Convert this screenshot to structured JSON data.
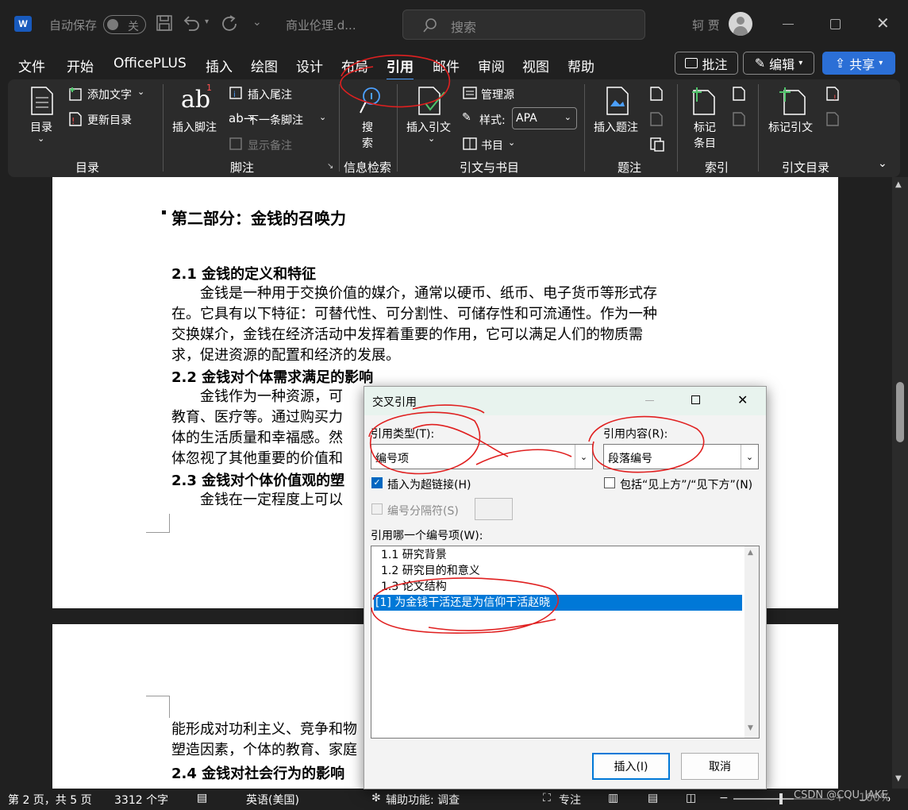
{
  "titlebar": {
    "autosave_label": "自动保存",
    "autosave_state": "关",
    "doc_name": "商业伦理.d...",
    "search_placeholder": "搜索",
    "user_name": "轲 贾"
  },
  "menu": {
    "items": [
      "文件",
      "开始",
      "OfficePLUS",
      "插入",
      "绘图",
      "设计",
      "布局",
      "引用",
      "邮件",
      "审阅",
      "视图",
      "帮助"
    ],
    "active": "引用",
    "comment_btn": "批注",
    "edit_btn": "编辑",
    "share_btn": "共享"
  },
  "ribbon": {
    "toc_btn": "目录",
    "add_text": "添加文字",
    "update_toc": "更新目录",
    "insert_footnote": "插入脚注",
    "insert_endnote": "插入尾注",
    "next_footnote": "下一条脚注",
    "show_notes": "显示备注",
    "search_1": "搜",
    "search_2": "索",
    "insert_citation": "插入引文",
    "manage_sources": "管理源",
    "style_label": "样式:",
    "style_value": "APA",
    "bibliography": "书目",
    "insert_caption": "插入题注",
    "mark_entry_1": "标记",
    "mark_entry_2": "条目",
    "mark_citation": "标记引文",
    "groups": [
      "目录",
      "脚注",
      "信息检索",
      "引文与书目",
      "题注",
      "索引",
      "引文目录"
    ]
  },
  "document": {
    "page1_heading": "第二部分：金钱的召唤力",
    "s21_title": "2.1  金钱的定义和特征",
    "s21_lines": [
      "　　金钱是一种用于交换价值的媒介，通常以硬币、纸币、电子货币等形式存",
      "在。它具有以下特征：可替代性、可分割性、可储存性和可流通性。作为一种",
      "交换媒介，金钱在经济活动中发挥着重要的作用，它可以满足人们的物质需",
      "求，促进资源的配置和经济的发展。"
    ],
    "s22_title": "2.2  金钱对个体需求满足的影响",
    "s22_lines": [
      "　　金钱作为一种资源，可",
      "教育、医疗等。通过购买力",
      "体的生活质量和幸福感。然",
      "体忽视了其他重要的价值和"
    ],
    "s23_title": "2.3  金钱对个体价值观的塑",
    "s23_line": "　　金钱在一定程度上可以",
    "page2_lines": [
      "能形成对功利主义、竞争和物",
      "塑造因素，个体的教育、家庭"
    ],
    "s24_title": "2.4  金钱对社会行为的影响"
  },
  "status": {
    "page": "第 2 页，共 5 页",
    "words": "3312 个字",
    "lang": "英语(美国)",
    "accessibility": "辅助功能: 调查",
    "focus": "专注",
    "zoom": "100%",
    "watermark": "CSDN @CQU_JAKE"
  },
  "dialog": {
    "title": "交叉引用",
    "ref_type_label": "引用类型(T):",
    "ref_type_value": "编号项",
    "ref_content_label": "引用内容(R):",
    "ref_content_value": "段落编号",
    "hyperlink_label": "插入为超链接(H)",
    "hyperlink_checked": true,
    "include_label": "包括“见上方”/“见下方”(N)",
    "separator_label": "编号分隔符(S)",
    "which_label": "引用哪一个编号项(W):",
    "items": [
      "1.1 研究背景",
      "1.2 研究目的和意义",
      "1.3 论文结构",
      "[1] 为金钱干活还是为信仰干活赵晓"
    ],
    "selected_index": 3,
    "insert_btn": "插入(I)",
    "cancel_btn": "取消"
  },
  "colors": {
    "accent": "#4ca0ff",
    "selection": "#0078d7",
    "annotation": "#e02020",
    "share": "#2b6fd6"
  }
}
